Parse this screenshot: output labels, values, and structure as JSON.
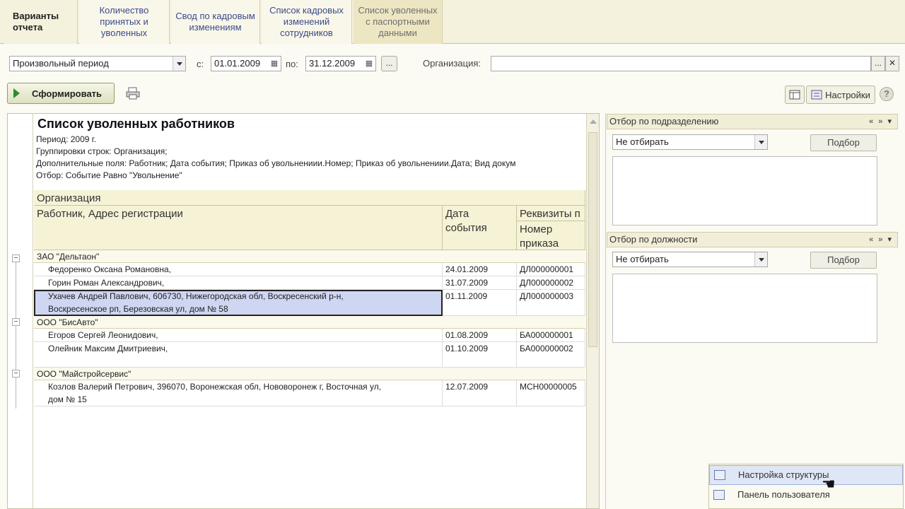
{
  "tabs": {
    "variants_label": "Варианты отчета",
    "items": [
      "Количество принятых и уволенных",
      "Свод по кадровым изменениям",
      "Список кадровых изменений сотрудников",
      "Список уволенных с паспортными данными"
    ]
  },
  "filter": {
    "period_select": "Произвольный период",
    "from_label": "с:",
    "from_date": "01.01.2009",
    "to_label": "по:",
    "to_date": "31.12.2009",
    "more_button": "...",
    "org_label": "Организация:",
    "org_value": "",
    "org_more": "..."
  },
  "toolbar": {
    "generate_label": "Сформировать",
    "settings_label": "Настройки",
    "help_label": "?"
  },
  "report": {
    "title": "Список уволенных работников",
    "meta": [
      "Период: 2009 г.",
      "Группировки строк: Организация;",
      "Дополнительные поля: Работник; Дата события; Приказ об увольнениии.Номер; Приказ об увольнениии.Дата; Вид докум",
      "Отбор: Событие Равно \"Увольнение\""
    ],
    "headers": {
      "organization": "Организация",
      "employee": "Работник, Адрес регистрации",
      "event_date_1": "Дата",
      "event_date_2": "события",
      "requisites": "Реквизиты п",
      "order_num_1": "Номер",
      "order_num_2": "приказа"
    },
    "groups": [
      {
        "name": "ЗАО \"Дельтаон\"",
        "rows": [
          {
            "employee": "Федоренко Оксана Романовна,",
            "employee2": "",
            "date": "24.01.2009",
            "num": "ДЛ000000001"
          },
          {
            "employee": "Горин Роман Александрович,",
            "employee2": "",
            "date": "31.07.2009",
            "num": "ДЛ000000002"
          },
          {
            "employee": "Ухачев Андрей Павлович, 606730, Нижегородская обл, Воскресенский р-н,",
            "employee2": "Воскресенское рп, Березовская ул, дом № 58",
            "date": "01.11.2009",
            "num": "ДЛ000000003"
          }
        ]
      },
      {
        "name": "ООО \"БисАвто\"",
        "rows": [
          {
            "employee": "Егоров Сергей Леонидович,",
            "employee2": "",
            "date": "01.08.2009",
            "num": "БА000000001"
          },
          {
            "employee": "Олейник Максим Дмитриевич,",
            "employee2": "",
            "date": "01.10.2009",
            "num": "БА000000002"
          }
        ]
      },
      {
        "name": "ООО \"Майстройсервис\"",
        "rows": [
          {
            "employee": "Козлов Валерий Петрович, 396070, Воронежская обл, Нововоронеж г, Восточная ул,",
            "employee2": "дом № 15",
            "date": "12.07.2009",
            "num": "МСН00000005"
          }
        ]
      }
    ]
  },
  "panels": {
    "dept_title": "Отбор по подразделению",
    "dept_select": "Не отбирать",
    "dept_pick": "Подбор",
    "pos_title": "Отбор по должности",
    "pos_select": "Не отбирать",
    "pos_pick": "Подбор",
    "nav_controls": "« » ▾"
  },
  "menu": {
    "items": [
      "Настройка структуры",
      "Панель пользователя"
    ]
  }
}
